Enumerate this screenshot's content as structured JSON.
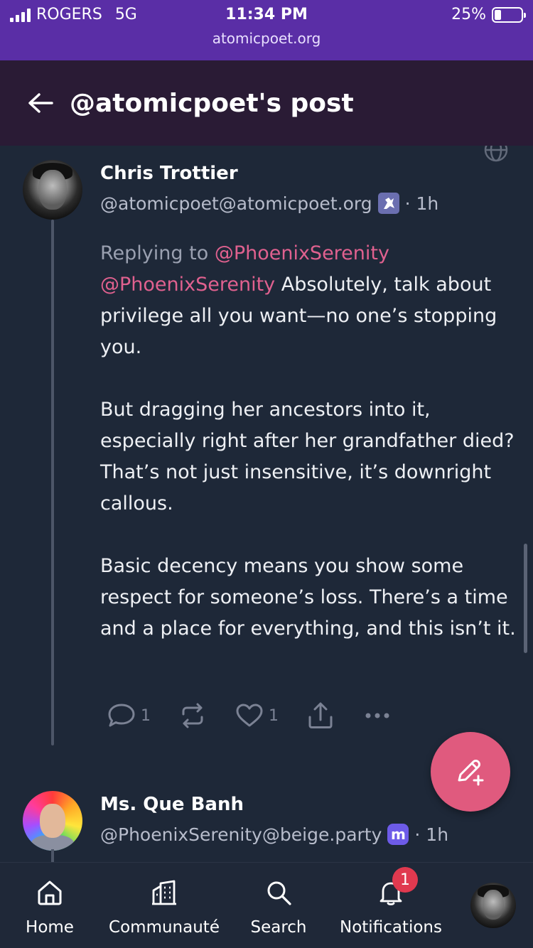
{
  "status_bar": {
    "carrier": "ROGERS",
    "network": "5G",
    "time": "11:34 PM",
    "url": "atomicpoet.org",
    "battery": "25%",
    "battery_level": 0.25
  },
  "header": {
    "title": "@atomicpoet's post"
  },
  "post": {
    "author_name": "Chris Trottier",
    "author_handle": "@atomicpoet@atomicpoet.org",
    "badge_icon": "bot-icon",
    "time": "· 1h",
    "replying_label": "Replying to",
    "replying_to": "@PhoenixSerenity",
    "mention": "@PhoenixSerenity",
    "paragraph1_rest": " Absolutely, talk about privilege all you want—no one’s stopping you.",
    "paragraph2": "But dragging her ancestors into it, especially right after her grandfather died? That’s not just insensitive, it’s downright callous.",
    "paragraph3": "Basic decency means you show some respect for someone’s loss. There’s a time and a place for everything, and this isn’t it.",
    "reply_count": "1",
    "favourite_count": "1"
  },
  "next_post": {
    "author_name": "Ms. Que Banh",
    "author_handle": "@PhoenixSerenity@beige.party",
    "badge_letter": "m",
    "time": "· 1h"
  },
  "nav": {
    "home": "Home",
    "community": "Communauté",
    "search": "Search",
    "notifications": "Notifications",
    "notification_badge": "1"
  },
  "colors": {
    "status_bar": "#5a2ea6",
    "header": "#2a1b35",
    "background": "#1e2838",
    "accent": "#e05a7e",
    "mention": "#e0618f"
  }
}
